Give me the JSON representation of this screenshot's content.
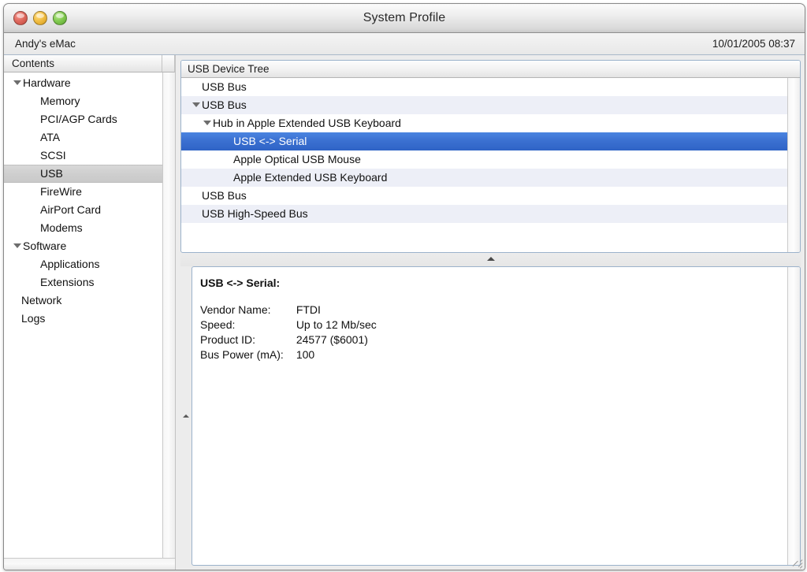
{
  "window": {
    "title": "System Profile",
    "traffic_lights": [
      "close",
      "minimize",
      "zoom"
    ]
  },
  "infobar": {
    "machine_name": "Andy's eMac",
    "timestamp": "10/01/2005 08:37"
  },
  "sidebar": {
    "header": "Contents",
    "items": [
      {
        "label": "Hardware",
        "level": 0,
        "twisty": "down",
        "selected": false
      },
      {
        "label": "Memory",
        "level": 1,
        "twisty": "",
        "selected": false
      },
      {
        "label": "PCI/AGP Cards",
        "level": 1,
        "twisty": "",
        "selected": false
      },
      {
        "label": "ATA",
        "level": 1,
        "twisty": "",
        "selected": false
      },
      {
        "label": "SCSI",
        "level": 1,
        "twisty": "",
        "selected": false
      },
      {
        "label": "USB",
        "level": 1,
        "twisty": "",
        "selected": true
      },
      {
        "label": "FireWire",
        "level": 1,
        "twisty": "",
        "selected": false
      },
      {
        "label": "AirPort Card",
        "level": 1,
        "twisty": "",
        "selected": false
      },
      {
        "label": "Modems",
        "level": 1,
        "twisty": "",
        "selected": false
      },
      {
        "label": "Software",
        "level": 0,
        "twisty": "down",
        "selected": false
      },
      {
        "label": "Applications",
        "level": 1,
        "twisty": "",
        "selected": false
      },
      {
        "label": "Extensions",
        "level": 1,
        "twisty": "",
        "selected": false
      },
      {
        "label": "Network",
        "level": 0,
        "twisty": "",
        "selected": false
      },
      {
        "label": "Logs",
        "level": 0,
        "twisty": "",
        "selected": false
      }
    ]
  },
  "tree_panel": {
    "header": "USB Device Tree",
    "rows": [
      {
        "label": "USB Bus",
        "level": 0,
        "twisty": "",
        "selected": false
      },
      {
        "label": "USB Bus",
        "level": 0,
        "twisty": "down",
        "selected": false
      },
      {
        "label": "Hub in Apple Extended USB Keyboard",
        "level": 1,
        "twisty": "down",
        "selected": false
      },
      {
        "label": "USB <-> Serial",
        "level": 2,
        "twisty": "",
        "selected": true
      },
      {
        "label": "Apple Optical USB Mouse",
        "level": 2,
        "twisty": "",
        "selected": false
      },
      {
        "label": "Apple Extended USB Keyboard",
        "level": 2,
        "twisty": "",
        "selected": false
      },
      {
        "label": "USB Bus",
        "level": 0,
        "twisty": "",
        "selected": false
      },
      {
        "label": "USB High-Speed Bus",
        "level": 0,
        "twisty": "",
        "selected": false
      }
    ],
    "selection_color": "#3a6fd0",
    "stripe_color": "#edeff7"
  },
  "detail_panel": {
    "title": "USB <-> Serial:",
    "fields": [
      {
        "label": "Vendor Name:",
        "value": "FTDI"
      },
      {
        "label": "Speed:",
        "value": "Up to 12 Mb/sec"
      },
      {
        "label": "Product ID:",
        "value": "24577 ($6001)"
      },
      {
        "label": "Bus Power (mA):",
        "value": "100"
      }
    ]
  }
}
